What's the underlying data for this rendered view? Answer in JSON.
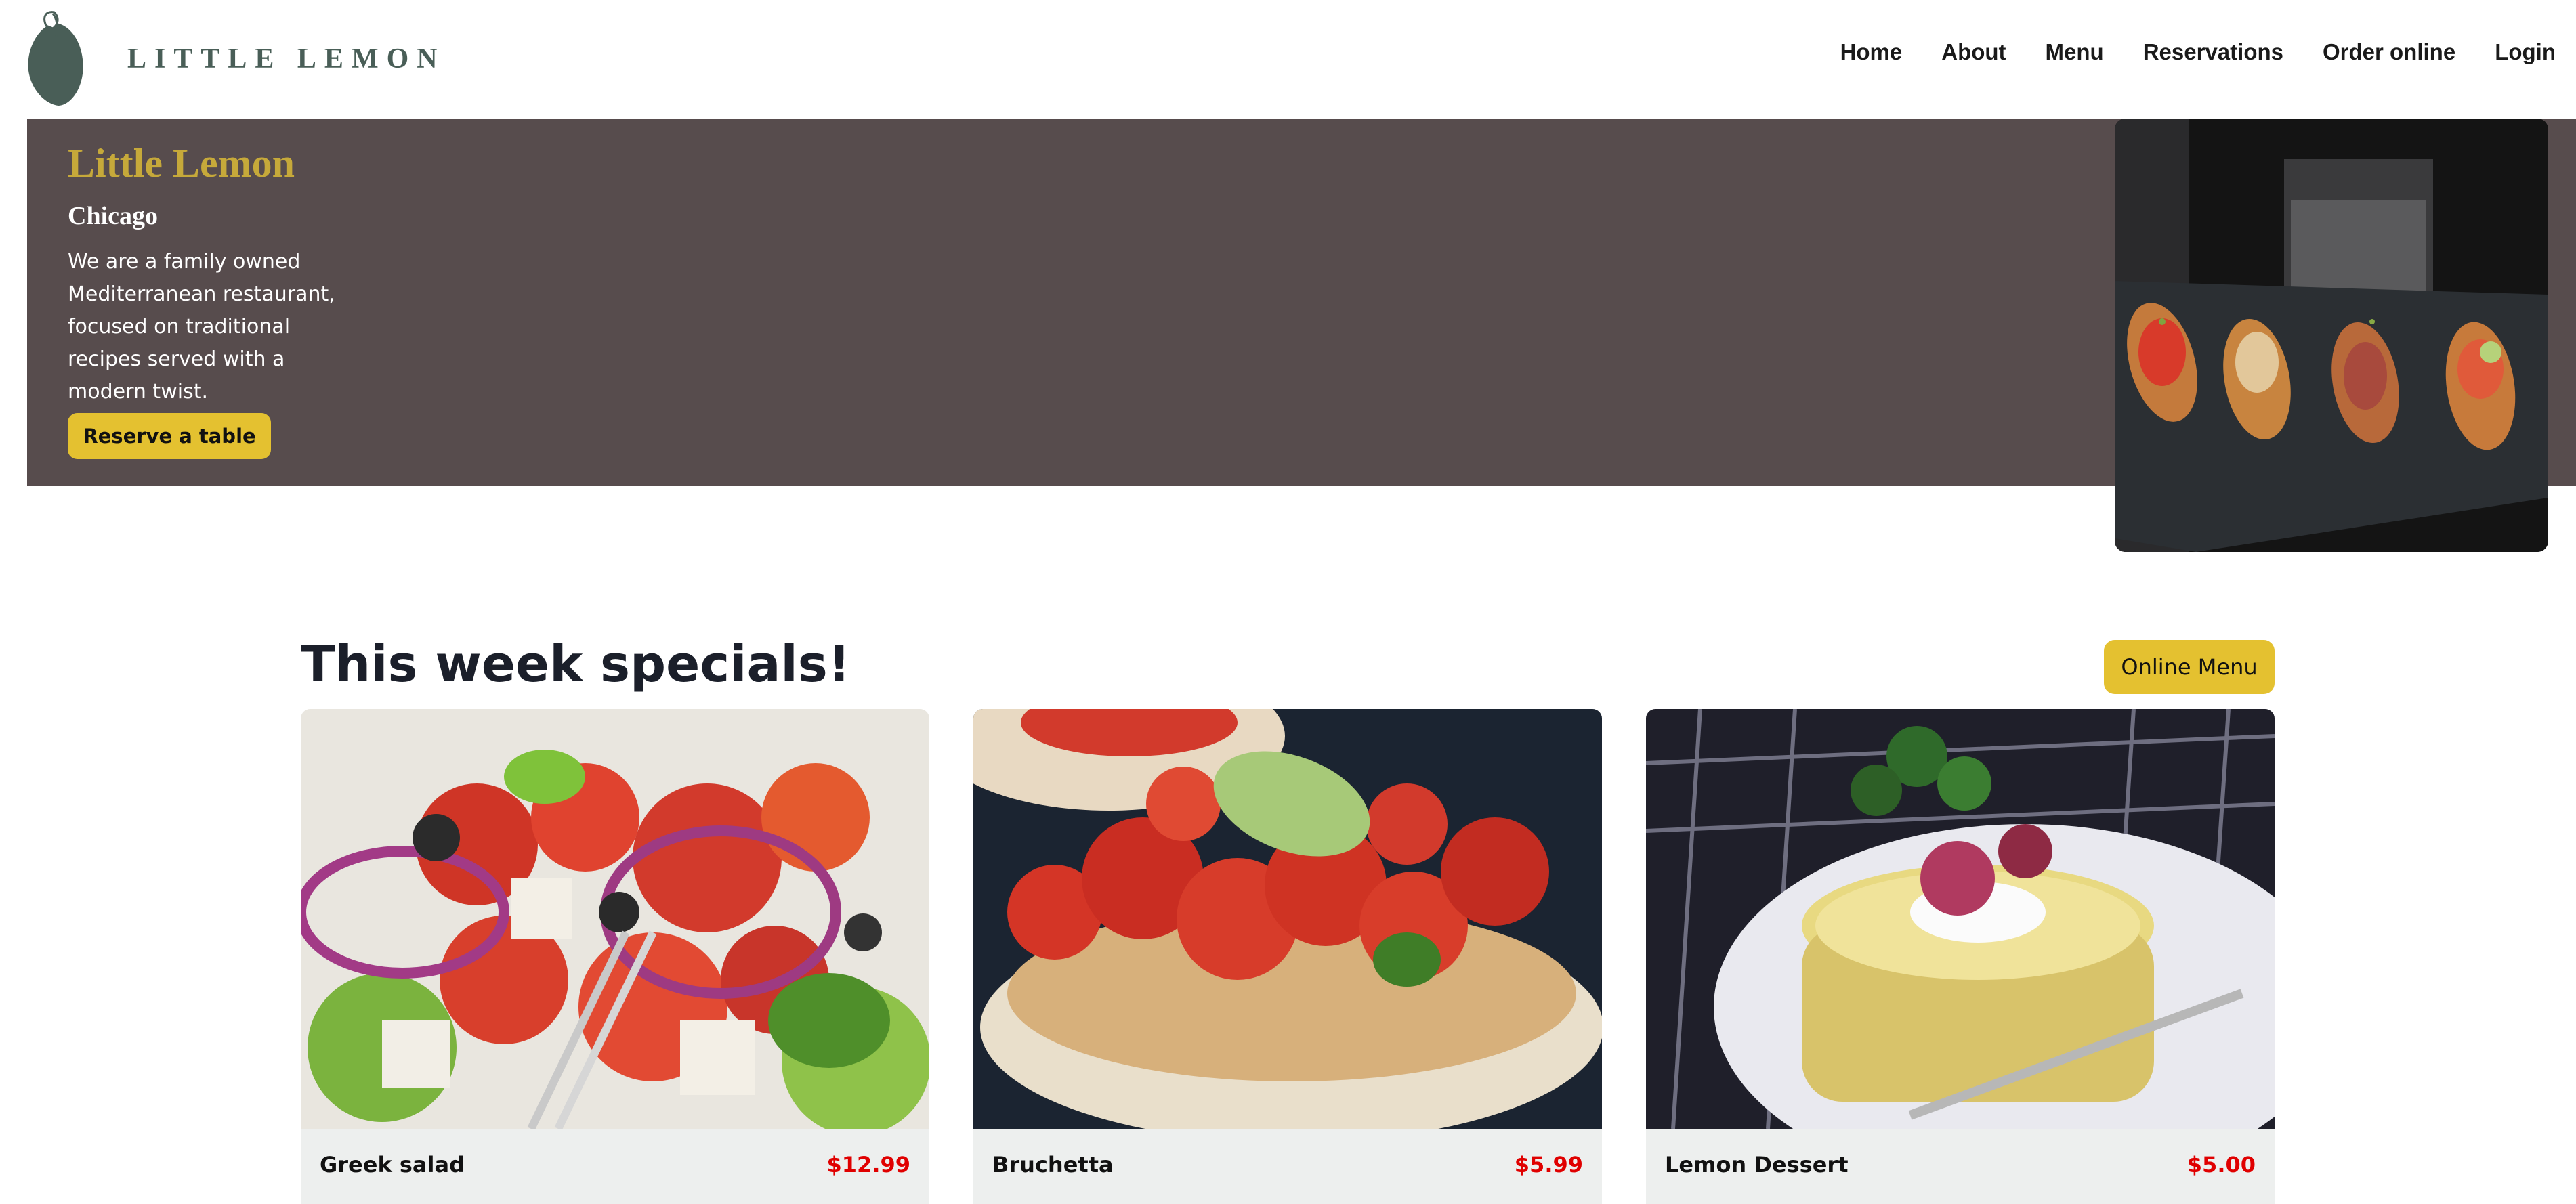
{
  "brand": {
    "logo_text": "LITTLE LEMON"
  },
  "nav": {
    "items": [
      {
        "label": "Home"
      },
      {
        "label": "About"
      },
      {
        "label": "Menu"
      },
      {
        "label": "Reservations"
      },
      {
        "label": "Order online"
      },
      {
        "label": "Login"
      }
    ]
  },
  "hero": {
    "title": "Little Lemon",
    "subtitle": "Chicago",
    "description": "We are a family owned Mediterranean restaurant, focused on traditional recipes served with a modern twist.",
    "cta_label": "Reserve a table"
  },
  "specials": {
    "heading": "This week specials!",
    "online_menu_label": "Online Menu",
    "items": [
      {
        "name": "Greek salad",
        "price": "$12.99"
      },
      {
        "name": "Bruchetta",
        "price": "$5.99"
      },
      {
        "name": "Lemon Dessert",
        "price": "$5.00"
      }
    ]
  },
  "colors": {
    "hero_bg": "#574c4d",
    "accent_yellow": "#e4c130",
    "title_gold": "#c6a93a",
    "brand_green": "#495e57",
    "price_red": "#e00000",
    "card_footer_bg": "#edefee"
  },
  "icons": {
    "logo": "lemon-icon"
  }
}
